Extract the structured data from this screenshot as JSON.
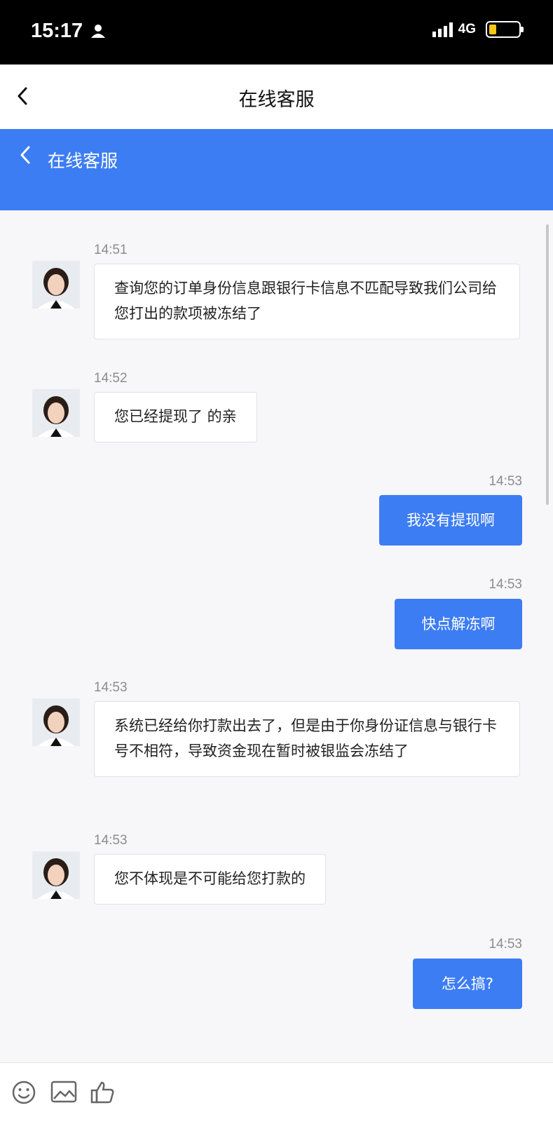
{
  "status_bar": {
    "time": "15:17",
    "network": "4G"
  },
  "title_bar": {
    "title": "在线客服"
  },
  "chat_header": {
    "title": "在线客服"
  },
  "messages": [
    {
      "side": "agent",
      "time": "14:51",
      "text": "查询您的订单身份信息跟银行卡信息不匹配导致我们公司给您打出的款项被冻结了"
    },
    {
      "side": "agent",
      "time": "14:52",
      "text": "您已经提现了 的亲"
    },
    {
      "side": "user",
      "time": "14:53",
      "text": "我没有提现啊"
    },
    {
      "side": "user",
      "time": "14:53",
      "text": "快点解冻啊"
    },
    {
      "side": "agent",
      "time": "14:53",
      "text": "系统已经给你打款出去了，但是由于你身份证信息与银行卡号不相符，导致资金现在暂时被银监会冻结了"
    },
    {
      "side": "agent",
      "time": "14:53",
      "text": "您不体现是不可能给您打款的"
    },
    {
      "side": "user",
      "time": "14:53",
      "text": "怎么搞?"
    }
  ],
  "input_bar": {
    "tools": [
      "smiley-icon",
      "image-icon",
      "thumbs-up-icon"
    ]
  },
  "colors": {
    "accent": "#3d7df3",
    "background": "#f7f7f9"
  }
}
